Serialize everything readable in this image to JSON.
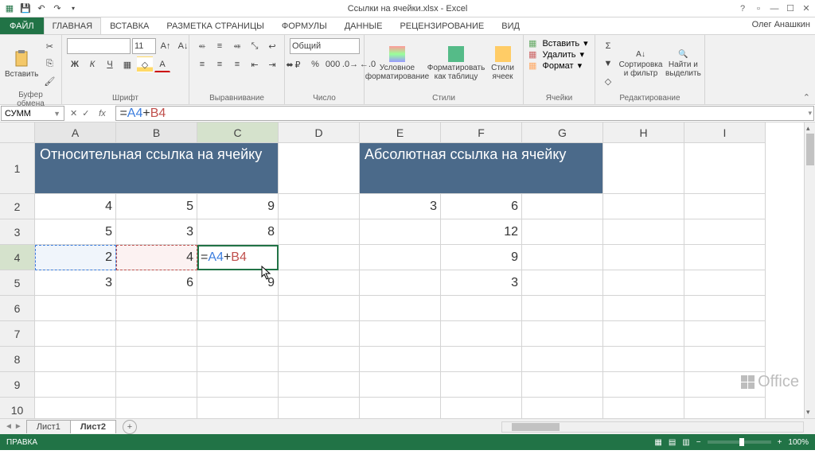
{
  "window": {
    "title": "Ссылки на ячейки.xlsx - Excel",
    "user": "Олег Анашкин"
  },
  "tabs": {
    "file": "ФАЙЛ",
    "items": [
      "ГЛАВНАЯ",
      "ВСТАВКА",
      "РАЗМЕТКА СТРАНИЦЫ",
      "ФОРМУЛЫ",
      "ДАННЫЕ",
      "РЕЦЕНЗИРОВАНИЕ",
      "ВИД"
    ],
    "active": 0
  },
  "ribbon": {
    "clipboard": {
      "paste": "Вставить",
      "label": "Буфер обмена"
    },
    "font": {
      "size": "11",
      "label": "Шрифт"
    },
    "align": {
      "label": "Выравнивание"
    },
    "number": {
      "format": "Общий",
      "label": "Число"
    },
    "styles": {
      "cond": "Условное форматирование",
      "table": "Форматировать как таблицу",
      "cell": "Стили ячеек",
      "label": "Стили"
    },
    "cells": {
      "insert": "Вставить",
      "delete": "Удалить",
      "format": "Формат",
      "label": "Ячейки"
    },
    "editing": {
      "sort": "Сортировка и фильтр",
      "find": "Найти и выделить",
      "label": "Редактирование"
    }
  },
  "formula_bar": {
    "namebox": "СУММ",
    "formula": "=A4+B4",
    "ref1": "A4",
    "ref2": "B4"
  },
  "cols": [
    "A",
    "B",
    "C",
    "D",
    "E",
    "F",
    "G",
    "H",
    "I"
  ],
  "rows": [
    "1",
    "2",
    "3",
    "4",
    "5",
    "6",
    "7",
    "8",
    "9",
    "10"
  ],
  "cells": {
    "header1": "Относительная ссылка на ячейку",
    "header2": "Абсолютная ссылка на ячейку",
    "A2": "4",
    "B2": "5",
    "C2": "9",
    "E2": "3",
    "F2": "6",
    "A3": "5",
    "B3": "3",
    "C3": "8",
    "F3": "12",
    "A4": "2",
    "B4": "4",
    "F4": "9",
    "A5": "3",
    "B5": "6",
    "C5": "9",
    "F5": "3"
  },
  "sheets": {
    "items": [
      "Лист1",
      "Лист2"
    ],
    "active": 1
  },
  "status": {
    "mode": "ПРАВКА",
    "zoom": "100%"
  }
}
